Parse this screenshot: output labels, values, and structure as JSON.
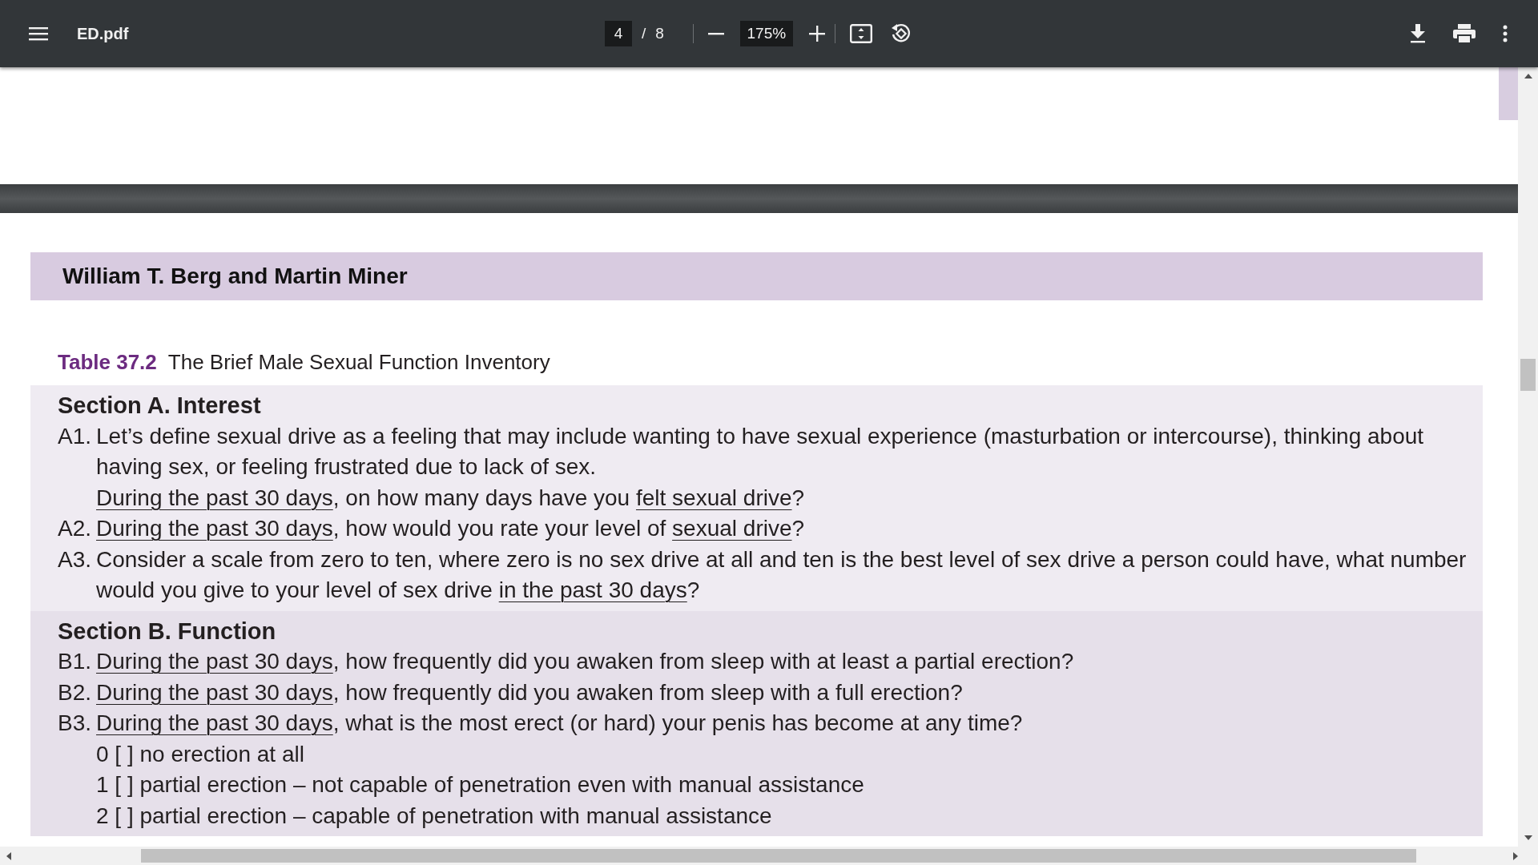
{
  "toolbar": {
    "title": "ED.pdf",
    "page_current": "4",
    "page_separator": "/",
    "page_total": "8",
    "zoom": "175%"
  },
  "page": {
    "running_header": "William T. Berg and Martin Miner",
    "table": {
      "label": "Table 37.2",
      "title": "The Brief Male Sexual Function Inventory"
    },
    "sections": [
      {
        "heading": "Section A. Interest",
        "items": [
          {
            "number": "A1.",
            "paragraphs": [
              [
                {
                  "text": "Let’s define sexual drive as a feeling that may include wanting to have sexual experience (masturbation or intercourse), thinking about having sex, or feeling frustrated due to lack of sex.",
                  "underlined": false
                }
              ],
              [
                {
                  "text": "During the past 30 days",
                  "underlined": true
                },
                {
                  "text": ", on how many days have you ",
                  "underlined": false
                },
                {
                  "text": "felt sexual drive",
                  "underlined": true
                },
                {
                  "text": "?",
                  "underlined": false
                }
              ]
            ]
          },
          {
            "number": "A2.",
            "paragraphs": [
              [
                {
                  "text": "During the past 30 days",
                  "underlined": true
                },
                {
                  "text": ", how would you rate your level of ",
                  "underlined": false
                },
                {
                  "text": "sexual drive",
                  "underlined": true
                },
                {
                  "text": "?",
                  "underlined": false
                }
              ]
            ]
          },
          {
            "number": "A3.",
            "paragraphs": [
              [
                {
                  "text": "Consider a scale from zero to ten, where zero is no sex drive at all and ten is the best level of sex drive a person could have, what number would you give to your level of sex drive ",
                  "underlined": false
                },
                {
                  "text": "in the past 30 days",
                  "underlined": true
                },
                {
                  "text": "?",
                  "underlined": false
                }
              ]
            ]
          }
        ]
      },
      {
        "heading": "Section B. Function",
        "items": [
          {
            "number": "B1.",
            "paragraphs": [
              [
                {
                  "text": "During the past 30 days",
                  "underlined": true
                },
                {
                  "text": ", how frequently did you awaken from sleep with at least a partial erection?",
                  "underlined": false
                }
              ]
            ]
          },
          {
            "number": "B2.",
            "paragraphs": [
              [
                {
                  "text": "During the past 30 days",
                  "underlined": true
                },
                {
                  "text": ", how frequently did you awaken from sleep with a full erection?",
                  "underlined": false
                }
              ]
            ]
          },
          {
            "number": "B3.",
            "paragraphs": [
              [
                {
                  "text": "During the past 30 days",
                  "underlined": true
                },
                {
                  "text": ", what is the most erect (or hard) your penis has become at any time?",
                  "underlined": false
                }
              ]
            ],
            "options": [
              "0 [ ] no erection at all",
              "1 [ ] partial erection – not capable of penetration even with manual assistance",
              "2 [ ] partial erection – capable of penetration with manual assistance"
            ]
          }
        ]
      }
    ]
  }
}
